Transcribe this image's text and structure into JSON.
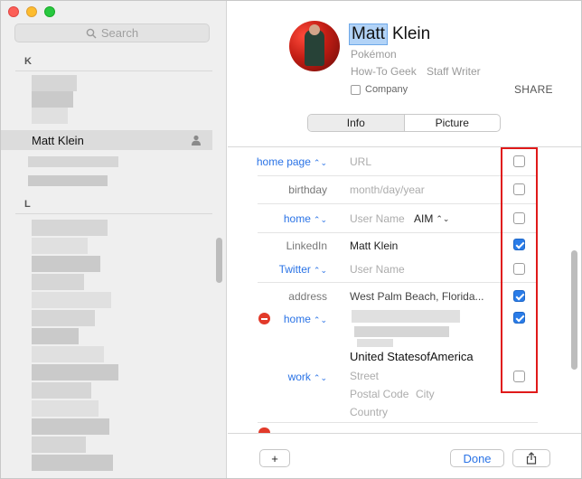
{
  "sidebar": {
    "search_placeholder": "Search",
    "section_k": "K",
    "section_l": "L",
    "selected_contact": "Matt Klein"
  },
  "card": {
    "first_name": "Matt",
    "last_name": "Klein",
    "nickname": "Pokémon",
    "company_title": "How-To Geek",
    "job_title": "Staff Writer",
    "company_label": "Company",
    "share_label": "SHARE"
  },
  "tabs": [
    "Info",
    "Picture"
  ],
  "fields": {
    "homepage_label": "home page",
    "homepage_placeholder": "URL",
    "birthday_label": "birthday",
    "birthday_placeholder": "month/day/year",
    "im_label": "home",
    "im_placeholder": "User Name",
    "im_service": "AIM",
    "linkedin_label": "LinkedIn",
    "linkedin_value": "Matt Klein",
    "twitter_label": "Twitter",
    "twitter_placeholder": "User Name",
    "address_label": "address",
    "address_value": "West Palm Beach, Florida...",
    "home_address_label": "home",
    "country_value": "United StatesofAmerica",
    "work_label": "work",
    "street_placeholder": "Street",
    "postal_placeholder": "Postal Code",
    "city_placeholder": "City",
    "country_placeholder": "Country"
  },
  "checkboxes": [
    false,
    false,
    false,
    true,
    false,
    true,
    true,
    false
  ],
  "footer": {
    "add_label": "+",
    "done_label": "Done"
  },
  "colors": {
    "accent": "#2a73e6",
    "highlight_box": "#e01a1a",
    "remove_red": "#e23a2a"
  }
}
